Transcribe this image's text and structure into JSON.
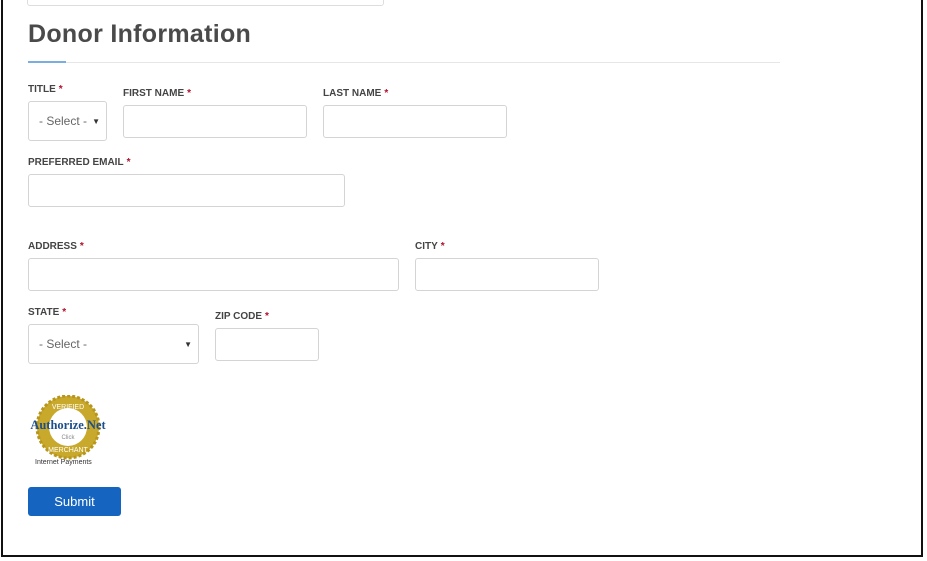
{
  "title": "Donor Information",
  "fields": {
    "title": {
      "label": "TITLE",
      "value": "- Select -"
    },
    "first_name": {
      "label": "FIRST NAME"
    },
    "last_name": {
      "label": "LAST NAME"
    },
    "email": {
      "label": "PREFERRED EMAIL"
    },
    "address": {
      "label": "ADDRESS"
    },
    "city": {
      "label": "CITY"
    },
    "state": {
      "label": "STATE",
      "value": "- Select -"
    },
    "zip": {
      "label": "ZIP CODE"
    }
  },
  "required_mark": "*",
  "badge": {
    "top": "VERIFIED",
    "brand": "Authorize.Net",
    "click": "Click",
    "bottom": "MERCHANT",
    "caption": "Internet Payments"
  },
  "submit_label": "Submit",
  "colors": {
    "accent": "#1565c0",
    "required": "#b0102a"
  }
}
